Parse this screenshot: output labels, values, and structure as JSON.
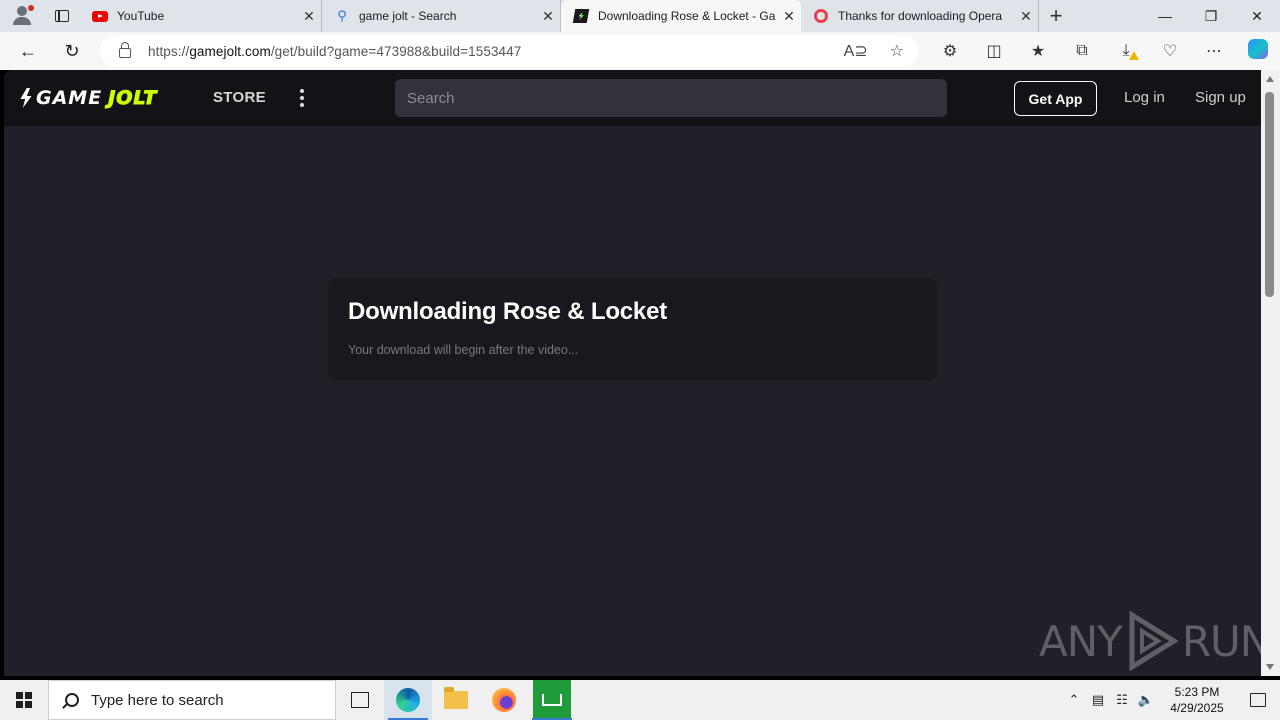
{
  "browser": {
    "tabs": [
      {
        "title": "YouTube",
        "favicon": "youtube-icon",
        "active": false
      },
      {
        "title": "game jolt - Search",
        "favicon": "search-icon",
        "active": false
      },
      {
        "title": "Downloading Rose & Locket - Ga",
        "favicon": "gamejolt-icon",
        "active": true
      },
      {
        "title": "Thanks for downloading Opera",
        "favicon": "opera-icon",
        "active": false
      }
    ],
    "url_prefix": "https://",
    "url_host": "gamejolt.com",
    "url_path": "/get/build?game=473988&build=1553447"
  },
  "site": {
    "logo_word": "GAME",
    "logo_word2": "JOLT",
    "nav_store": "STORE",
    "search_placeholder": "Search",
    "get_app": "Get App",
    "login": "Log in",
    "signup": "Sign up",
    "accent": "#ccff00",
    "background": "#221f28"
  },
  "download": {
    "title": "Downloading Rose & Locket",
    "subtitle": "Your download will begin after the video..."
  },
  "watermark": {
    "left": "ANY",
    "right": "RUN"
  },
  "taskbar": {
    "search_placeholder": "Type here to search",
    "time": "5:23 PM",
    "date": "4/29/2025"
  }
}
